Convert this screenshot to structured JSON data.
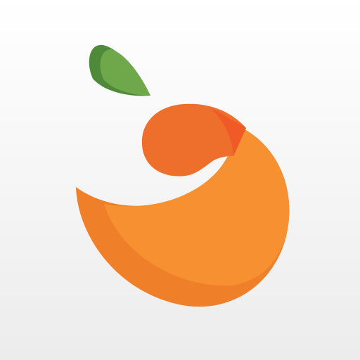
{
  "icon": {
    "name": "orange-fruit-logo",
    "colors": {
      "background_top": "#ffffff",
      "background_bottom": "#ececec",
      "leaf_dark": "#4f8a3a",
      "leaf_light": "#6ea84a",
      "orange_main": "#f69031",
      "orange_shade": "#f07f2a",
      "orange_dark": "#ee6f2b",
      "orange_accent": "#ef5a26"
    }
  }
}
